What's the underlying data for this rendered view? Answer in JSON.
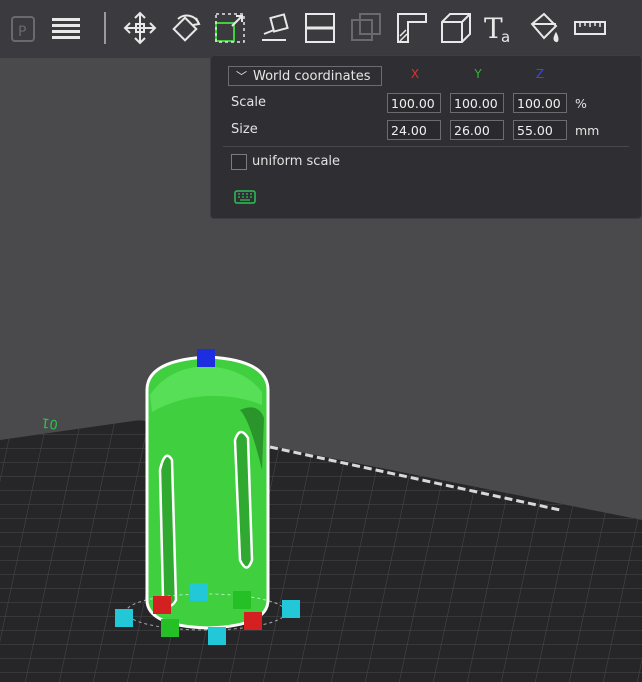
{
  "toolbar": {
    "tools": [
      {
        "name": "arrange-icon"
      },
      {
        "name": "layers-menu-icon"
      },
      {
        "name": "move-icon"
      },
      {
        "name": "rotate-icon"
      },
      {
        "name": "scale-icon"
      },
      {
        "name": "lay-on-face-icon"
      },
      {
        "name": "cut-icon"
      },
      {
        "name": "support-paint-icon"
      },
      {
        "name": "seam-paint-icon"
      },
      {
        "name": "variable-layer-height-icon"
      },
      {
        "name": "text-tool-icon"
      },
      {
        "name": "color-paint-icon"
      },
      {
        "name": "measure-icon"
      }
    ]
  },
  "scale_panel": {
    "coord_system": "World coordinates",
    "axes": {
      "x": "X",
      "y": "Y",
      "z": "Z"
    },
    "scale_label": "Scale",
    "scale": {
      "x": "100.00",
      "y": "100.00",
      "z": "100.00",
      "unit": "%"
    },
    "size_label": "Size",
    "size": {
      "x": "24.00",
      "y": "26.00",
      "z": "55.00",
      "unit": "mm"
    },
    "uniform_scale_label": "uniform scale",
    "uniform_scale_checked": false
  },
  "plate": {
    "label": "01"
  },
  "colors": {
    "axis_x": "#e03030",
    "axis_y": "#2fb82f",
    "axis_z": "#3848e8",
    "model": "#3fcf3f",
    "handle_cyan": "#22c8d8"
  }
}
